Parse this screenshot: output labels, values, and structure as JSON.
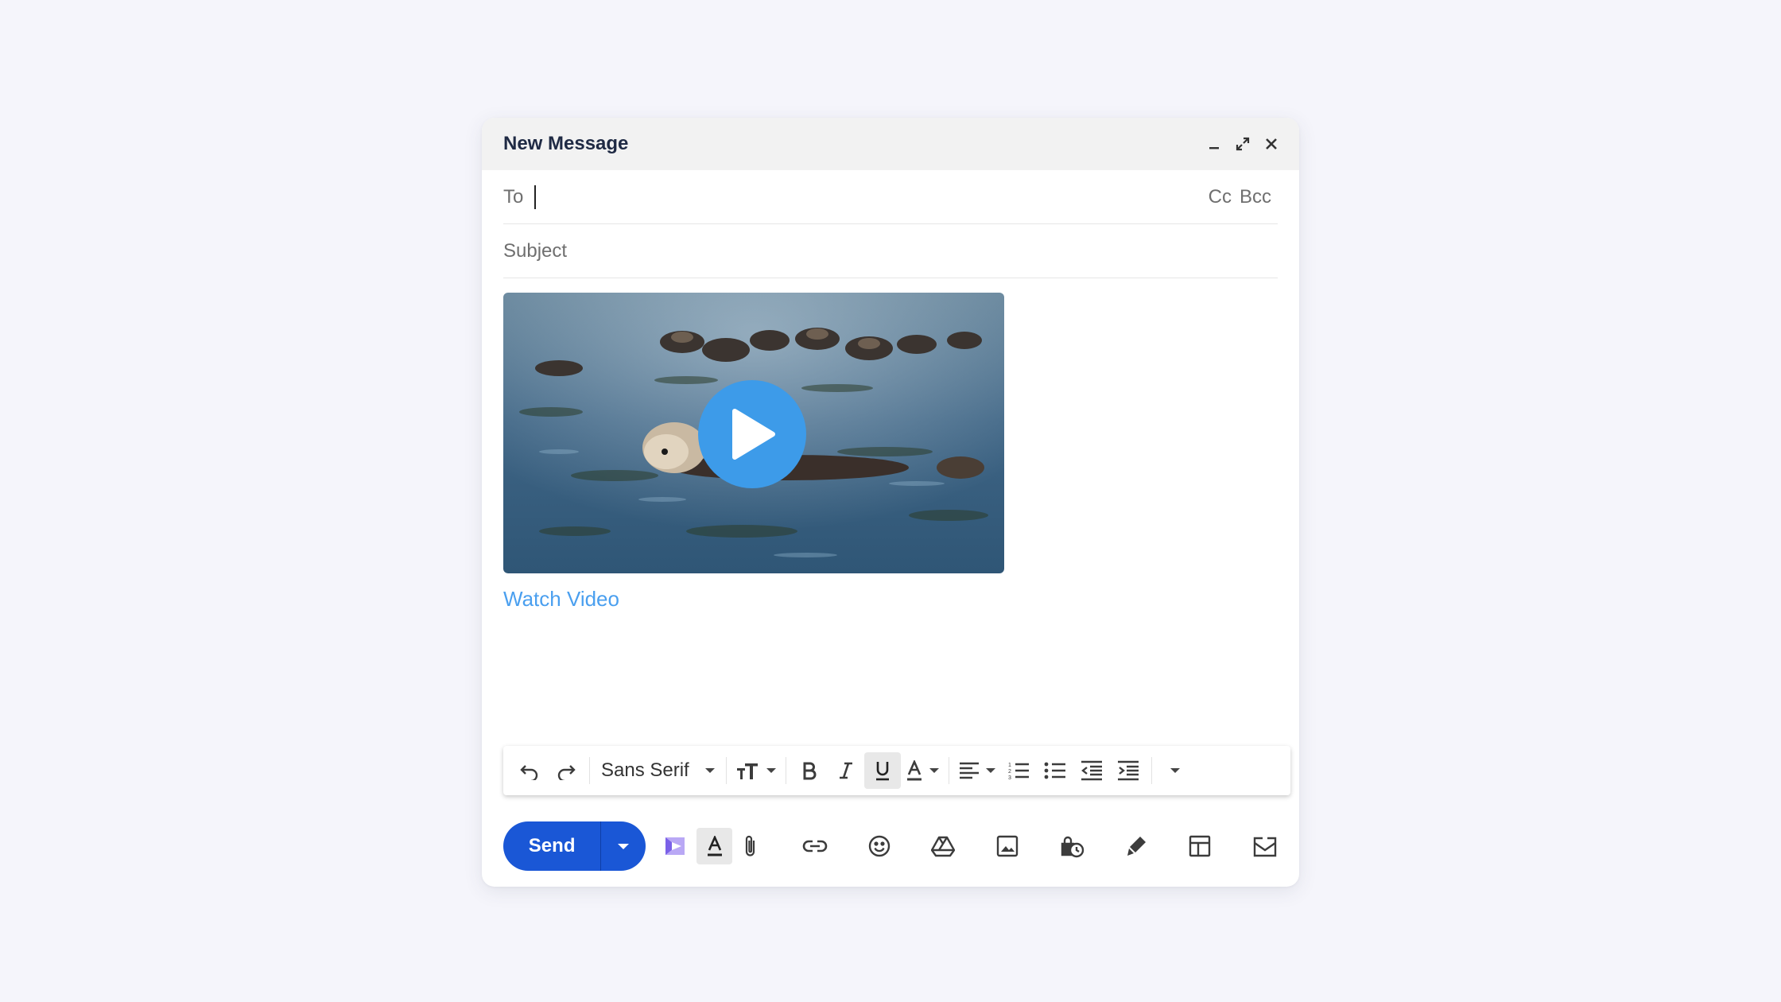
{
  "compose": {
    "title": "New Message",
    "window_actions": [
      "minimize-icon",
      "expand-icon",
      "close-icon"
    ]
  },
  "to_field": {
    "label": "To",
    "value": "",
    "cc_label": "Cc",
    "bcc_label": "Bcc"
  },
  "subject_field": {
    "placeholder": "Subject",
    "value": ""
  },
  "body": {
    "video_link_text": "Watch Video",
    "video_thumbnail": "sea-otters-in-water",
    "play_icon": "play-icon"
  },
  "format_toolbar": {
    "font_family": "Sans Serif",
    "buttons": [
      "undo-icon",
      "redo-icon",
      "font-family-select",
      "font-size-icon",
      "bold-icon",
      "italic-icon",
      "underline-icon",
      "text-color-icon",
      "align-icon",
      "numbered-list-icon",
      "bulleted-list-icon",
      "indent-less-icon",
      "indent-more-icon",
      "more-formatting-icon"
    ],
    "active": [
      "underline-icon"
    ]
  },
  "bottom_toolbar": {
    "send_label": "Send",
    "icons": [
      "extension-icon",
      "formatting-options-icon",
      "attach-icon",
      "link-icon",
      "emoji-icon",
      "drive-icon",
      "photo-icon",
      "confidential-mode-icon",
      "signature-icon",
      "layout-icon",
      "more-options-icon"
    ]
  },
  "colors": {
    "background": "#f5f5fb",
    "send_button": "#1a57d6",
    "link": "#4a9fef",
    "play_button": "#3d9be9",
    "titlebar": "#f2f2f2"
  }
}
